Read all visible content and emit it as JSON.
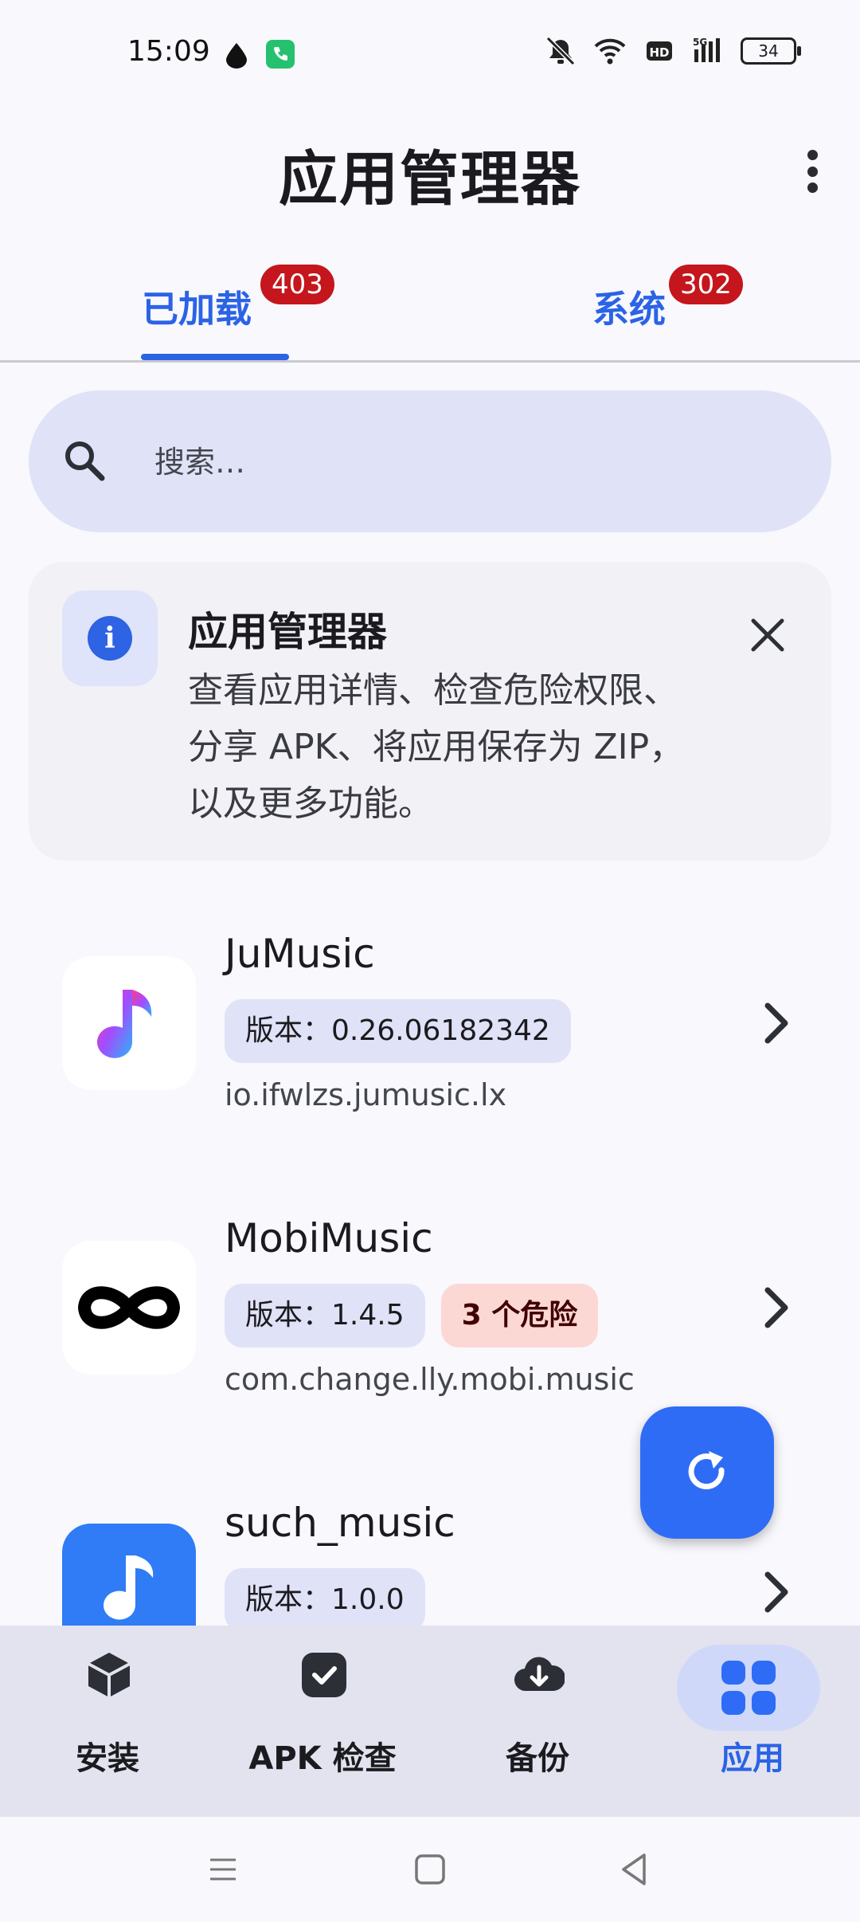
{
  "status_bar": {
    "time": "15:09",
    "battery": "34",
    "icons": [
      "drop-icon",
      "phone-icon",
      "mute-icon",
      "wifi-icon",
      "hd-icon",
      "signal-5g-icon",
      "battery-icon"
    ]
  },
  "header": {
    "title": "应用管理器",
    "menu_icon": "more-vert-icon"
  },
  "tabs": [
    {
      "label": "已加载",
      "badge": "403",
      "active": true
    },
    {
      "label": "系统",
      "badge": "302",
      "active": false
    }
  ],
  "search": {
    "placeholder": "搜索…"
  },
  "info_card": {
    "title": "应用管理器",
    "text": "查看应用详情、检查危险权限、分享 APK、将应用保存为 ZIP，以及更多功能。"
  },
  "apps": [
    {
      "name": "JuMusic",
      "version": "版本：0.26.06182342",
      "package": "io.ifwlzs.jumusic.lx"
    },
    {
      "name": "MobiMusic",
      "version": "版本：1.4.5",
      "danger": "3 个危险",
      "package": "com.change.lly.mobi.music"
    },
    {
      "name": "such_music",
      "version": "版本：1.0.0"
    }
  ],
  "bottom_nav": [
    {
      "label": "安装",
      "icon": "package-icon"
    },
    {
      "label": "APK 检查",
      "icon": "check-badge-icon"
    },
    {
      "label": "备份",
      "icon": "cloud-download-icon"
    },
    {
      "label": "应用",
      "icon": "apps-grid-icon",
      "active": true
    }
  ],
  "colors": {
    "accent": "#2b63e6",
    "badge": "#c4161c",
    "danger_chip": "#fcd8d4",
    "chip": "#e0e2f7"
  }
}
